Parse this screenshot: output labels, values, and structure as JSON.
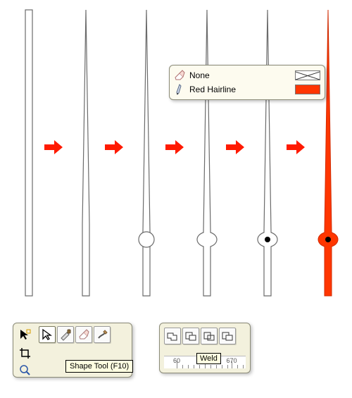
{
  "outline_panel": {
    "rows": [
      {
        "icon": "eraser-icon",
        "label": "None",
        "swatch": "none"
      },
      {
        "icon": "pen-icon",
        "label": "Red Hairline",
        "swatch": "red"
      }
    ]
  },
  "shape_toolbar": {
    "tooltip": "Shape Tool (F10)"
  },
  "weld_toolbar": {
    "tooltip": "Weld",
    "ruler": {
      "labels": [
        "60",
        "670"
      ]
    }
  },
  "colors": {
    "arrow": "#ff1a00",
    "hand_outline": "#6b6b6b",
    "hand_fill_red": "#ff3600"
  }
}
